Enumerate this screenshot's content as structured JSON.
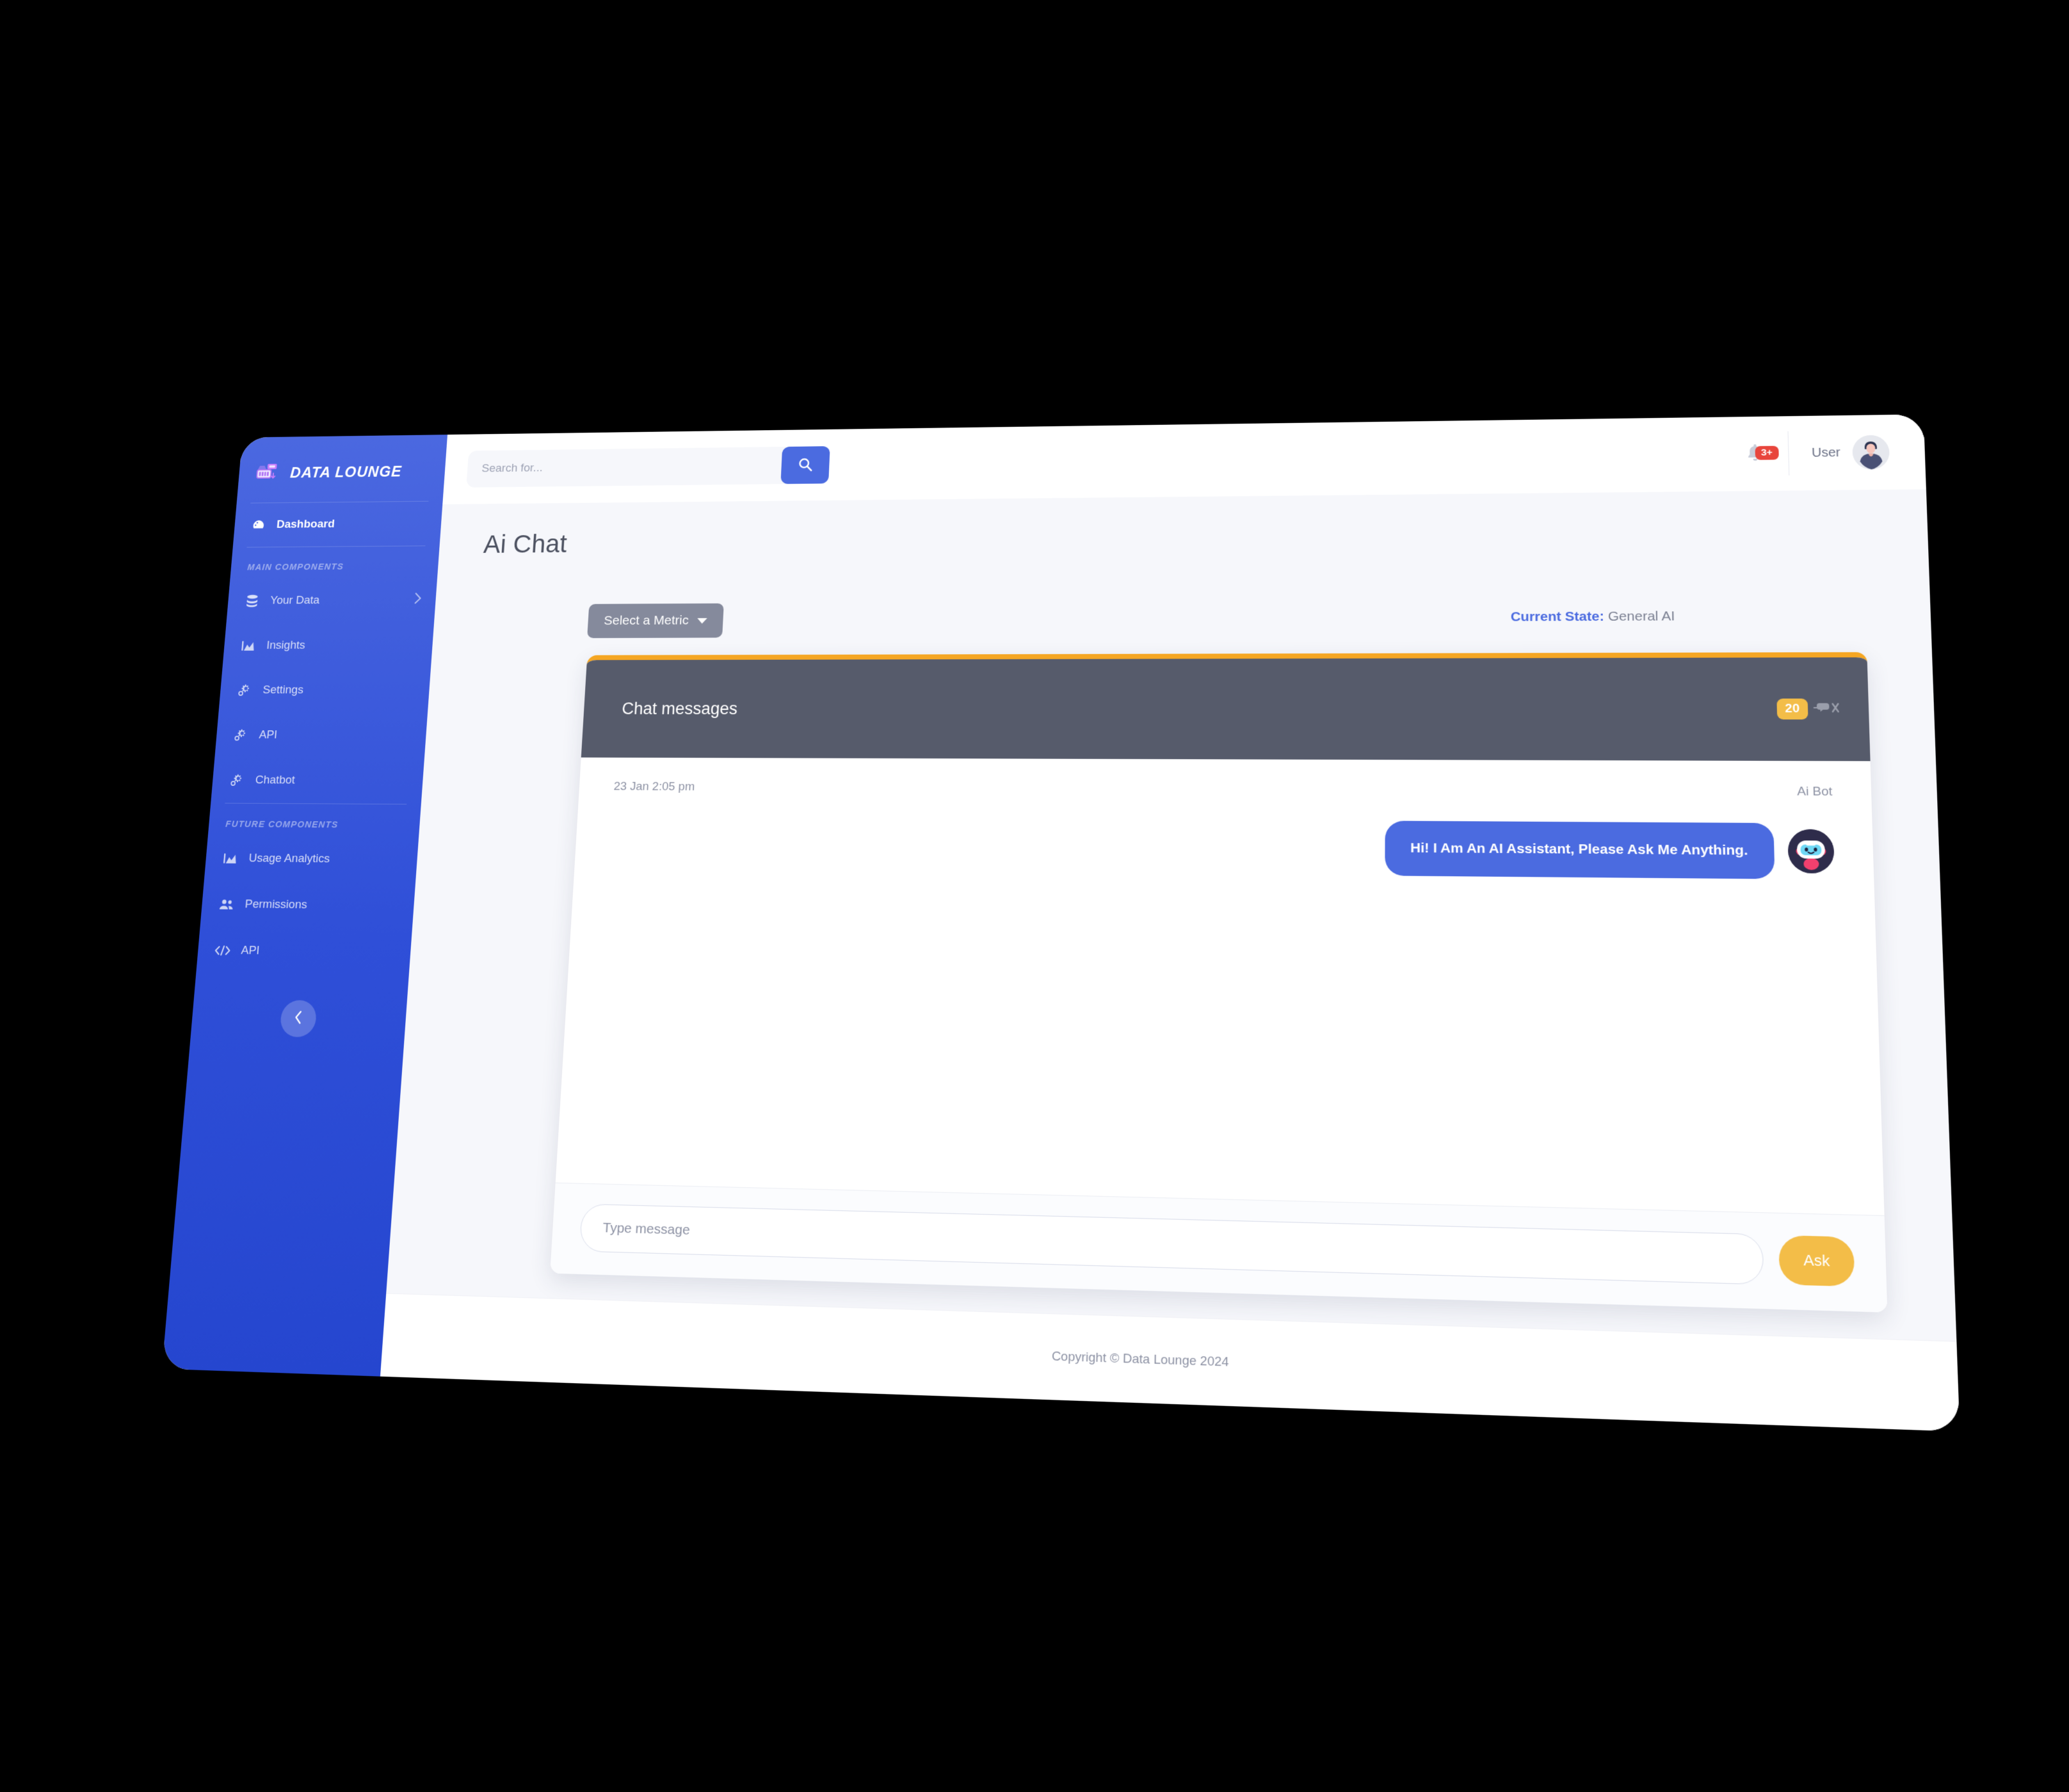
{
  "sidebar": {
    "brand": "DATA LOUNGE",
    "brand_logo_icon": "server-rack-icon",
    "items": [
      {
        "label": "Dashboard",
        "icon": "speedometer-icon",
        "active": true,
        "has_caret": false
      },
      {
        "label": "Your Data",
        "icon": "database-icon",
        "active": false,
        "has_caret": true
      },
      {
        "label": "Insights",
        "icon": "area-chart-icon",
        "active": false,
        "has_caret": false
      },
      {
        "label": "Settings",
        "icon": "gears-icon",
        "active": false,
        "has_caret": false
      },
      {
        "label": "API",
        "icon": "gears-icon",
        "active": false,
        "has_caret": false
      },
      {
        "label": "Chatbot",
        "icon": "gears-icon",
        "active": false,
        "has_caret": false
      },
      {
        "label": "Usage Analytics",
        "icon": "area-chart-icon",
        "active": false,
        "has_caret": false
      },
      {
        "label": "Permissions",
        "icon": "users-icon",
        "active": false,
        "has_caret": false
      },
      {
        "label": "API",
        "icon": "code-icon",
        "active": false,
        "has_caret": false
      }
    ],
    "heading_main": "MAIN COMPONENTS",
    "heading_future": "FUTURE COMPONENTS",
    "collapse_icon": "chevron-left-icon",
    "accent": "#2f4fd8"
  },
  "topbar": {
    "search_placeholder": "Search for...",
    "search_value": "",
    "search_icon": "search-icon",
    "bell_icon": "bell-icon",
    "notification_count": "3+",
    "notification_color": "#e8453c",
    "user_label": "User",
    "avatar_icon": "user-avatar"
  },
  "page": {
    "title": "Ai Chat",
    "metric_button": "Select a Metric",
    "metric_caret_icon": "caret-down-icon",
    "state_label": "Current State:",
    "state_value": "General AI",
    "state_label_color": "#4b6be0"
  },
  "chat": {
    "header_title": "Chat messages",
    "count_badge": "20",
    "count_badge_color": "#f3bd48",
    "header_icon": "comment-slash-icon",
    "accent_top": "#f5a623",
    "timestamp": "23 Jan 2:05 pm",
    "sender": "Ai Bot",
    "bot_avatar_icon": "robot-avatar",
    "messages": [
      {
        "text": "Hi! I Am An AI Assistant, Please Ask Me Anything.",
        "side": "right",
        "bubble_color": "#4b6be0"
      }
    ],
    "input_placeholder": "Type message",
    "input_value": "",
    "send_button": "Ask",
    "send_button_color": "#f3bd48"
  },
  "footer": {
    "copyright": "Copyright © Data Lounge 2024"
  }
}
